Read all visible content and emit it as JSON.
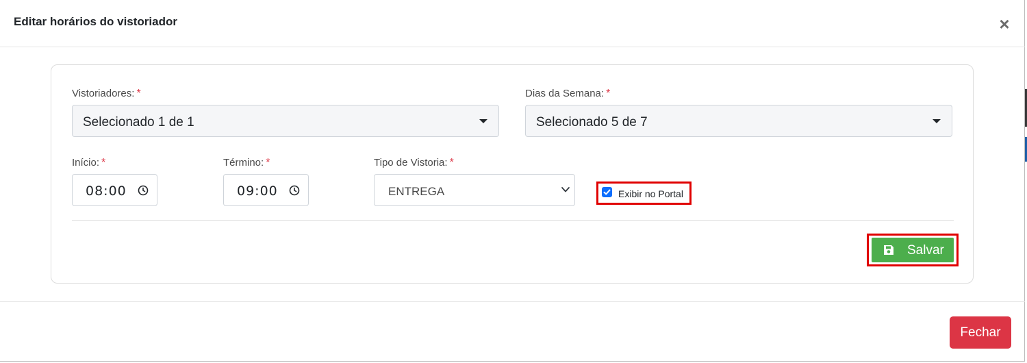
{
  "modal": {
    "title": "Editar horários do vistoriador",
    "close_glyph": "×"
  },
  "form": {
    "vistoriadores": {
      "label": "Vistoriadores:",
      "required": "*",
      "value": "Selecionado 1 de 1"
    },
    "dias_semana": {
      "label": "Dias da Semana:",
      "required": "*",
      "value": "Selecionado 5 de 7"
    },
    "inicio": {
      "label": "Início:",
      "required": "*",
      "value": "08:00"
    },
    "termino": {
      "label": "Término:",
      "required": "*",
      "value": "09:00"
    },
    "tipo_vistoria": {
      "label": "Tipo de Vistoria:",
      "required": "*",
      "value": "ENTREGA"
    },
    "exibir_portal": {
      "label": "Exibir no Portal",
      "checked": true
    },
    "save_label": "Salvar"
  },
  "footer": {
    "fechar_label": "Fechar"
  },
  "icons": {
    "close": "close-icon",
    "caret": "caret-down-icon",
    "clock": "clock-icon",
    "chevron": "chevron-down-icon",
    "check": "check-icon",
    "save": "floppy-disk-icon"
  },
  "colors": {
    "save_button": "#4cae4c",
    "fechar_button": "#dc3545",
    "highlight_outline": "#e00000",
    "checkbox": "#0d6efd",
    "required": "#dc3545"
  }
}
